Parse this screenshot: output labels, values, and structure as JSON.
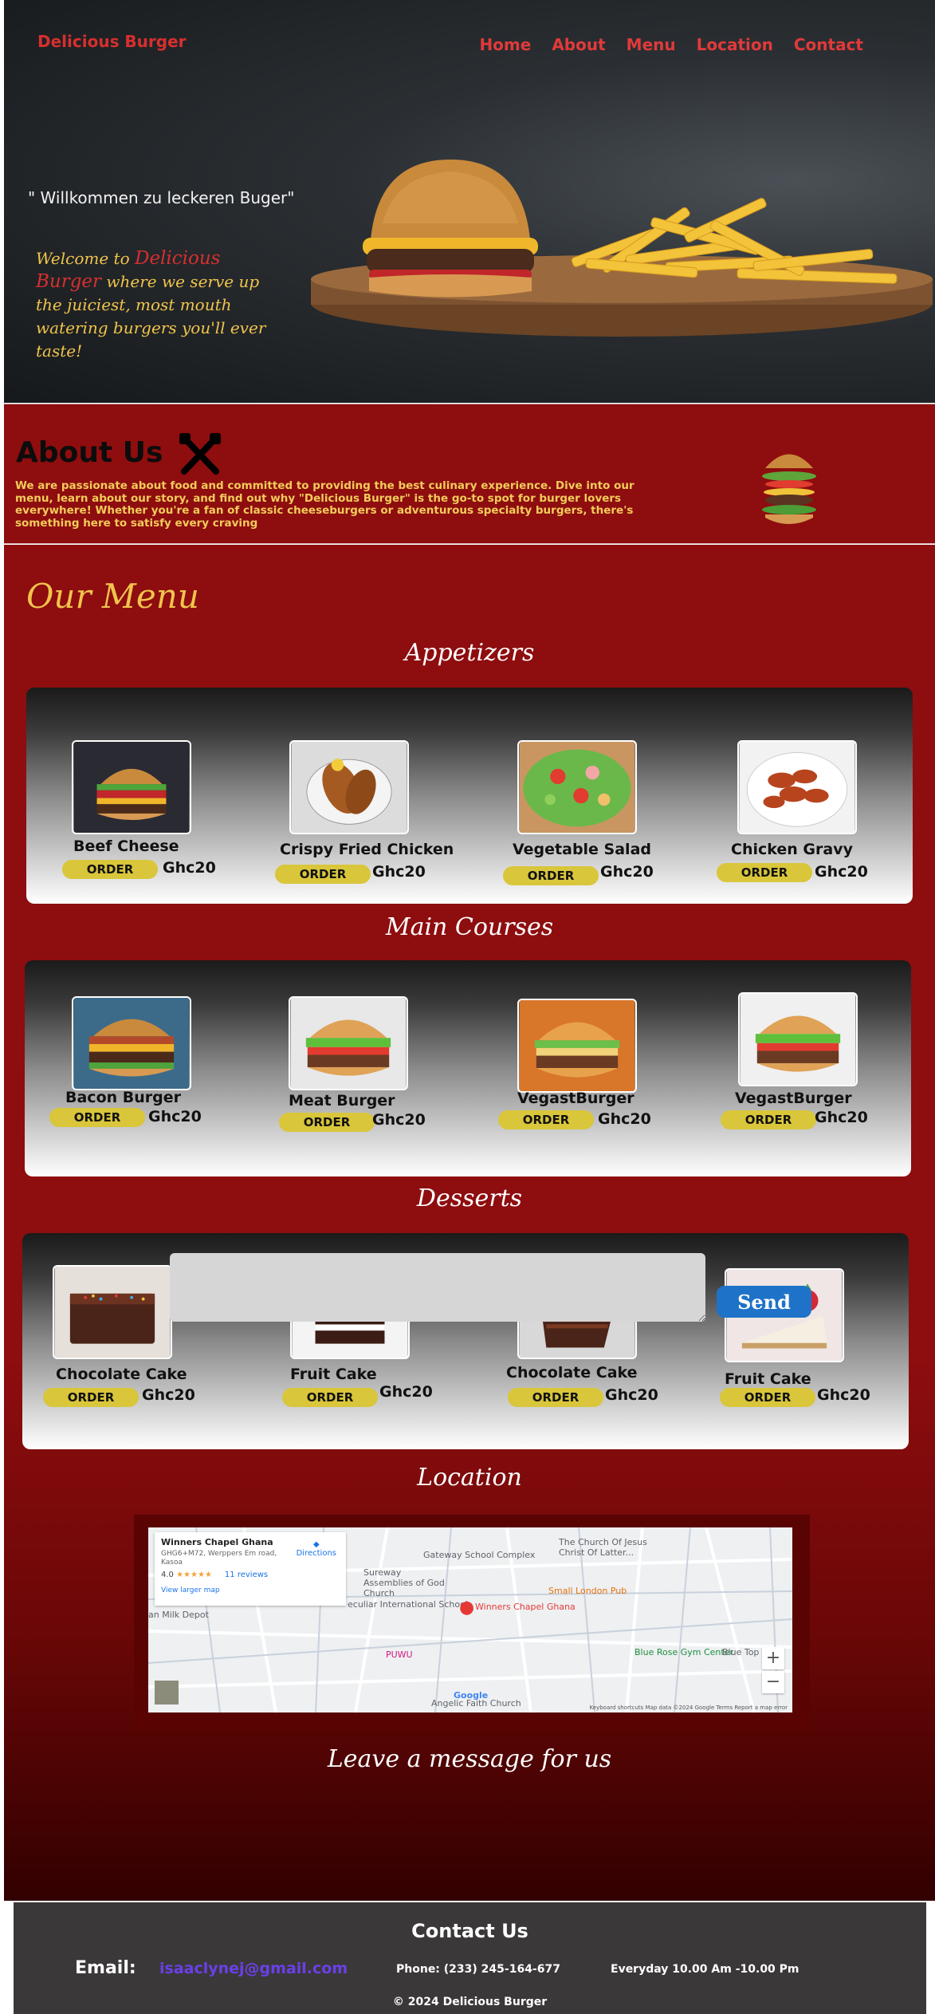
{
  "header": {
    "brand": "Delicious Burger",
    "nav": [
      "Home",
      "About",
      "Menu",
      "Location",
      "Contact"
    ]
  },
  "hero": {
    "quote": "\" Willkommen zu leckeren Buger\"",
    "welcome_prefix": "Welcome to ",
    "welcome_brand_1": "Delicious",
    "welcome_brand_2": "Burger",
    "welcome_rest": " where we serve up  the juiciest, most mouth watering burgers you'll ever taste!"
  },
  "about": {
    "title": "About Us",
    "text": "We are passionate about food and committed to providing the best culinary experience. Dive into our menu, learn about our story, and find out why \"Delicious Burger\" is the go-to spot for burger lovers everywhere! Whether you're a fan of classic cheeseburgers or adventurous specialty burgers, there's something here to satisfy every craving"
  },
  "menu": {
    "title": "Our Menu",
    "order_label": "ORDER",
    "sections": [
      {
        "title": "Appetizers",
        "items": [
          {
            "name": "Beef Cheese",
            "price": "Ghc20"
          },
          {
            "name": "Crispy Fried Chicken",
            "price": "Ghc20"
          },
          {
            "name": "Vegetable Salad",
            "price": "Ghc20"
          },
          {
            "name": "Chicken Gravy",
            "price": "Ghc20"
          }
        ]
      },
      {
        "title": "Main Courses",
        "items": [
          {
            "name": "Bacon Burger",
            "price": "Ghc20"
          },
          {
            "name": "Meat Burger",
            "price": "Ghc20"
          },
          {
            "name": "VegastBurger",
            "price": "Ghc20"
          },
          {
            "name": "VegastBurger",
            "price": "Ghc20"
          }
        ]
      },
      {
        "title": "Desserts",
        "items": [
          {
            "name": "Chocolate Cake",
            "price": "Ghc20"
          },
          {
            "name": "Fruit Cake",
            "price": "Ghc20"
          },
          {
            "name": "Chocolate Cake",
            "price": "Ghc20"
          },
          {
            "name": "Fruit Cake",
            "price": "Ghc20"
          }
        ]
      }
    ]
  },
  "location": {
    "title": "Location",
    "map": {
      "place": "Winners Chapel Ghana",
      "address": "GHG6+M72, Werppers Em road, Kasoa",
      "rating": "4.0",
      "stars": "★★★★★",
      "reviews": "11 reviews",
      "larger_map": "View larger map",
      "directions": "Directions",
      "labels": {
        "gateway": "Gateway School Complex",
        "church_latter": "The Church Of Jesus Christ Of Latter...",
        "sureway": "Sureway Assemblies of God Church",
        "peculiar": "eculiar International School",
        "milk": "an Milk Depot",
        "small_london": "Small London Pub",
        "winners": "Winners Chapel Ghana",
        "puwu": "PUWU",
        "blue_rose": "Blue Rose Gym Center",
        "blue_top": "Blue Top",
        "angelic": "Angelic Faith Church"
      },
      "zoom_in": "+",
      "zoom_out": "−",
      "footer": "Keyboard shortcuts   Map data ©2024 Google   Terms   Report a map error",
      "google": "Google"
    }
  },
  "message": {
    "title": "Leave a message for us",
    "send_label": "Send"
  },
  "footer": {
    "title": "Contact Us",
    "email_label": "Email:",
    "email": "isaaclynej@gmail.com",
    "phone": "Phone: (233) 245-164-677",
    "hours": "Everyday 10.00 Am -10.00 Pm",
    "copyright": "© 2024 Delicious Burger"
  }
}
